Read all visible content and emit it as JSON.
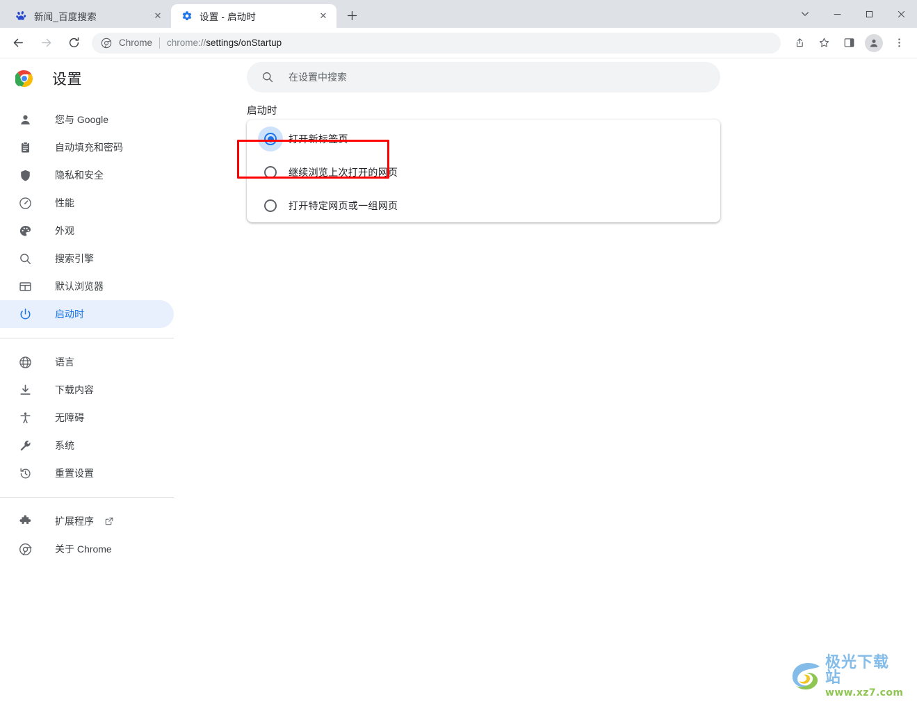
{
  "window": {
    "controls": [
      {
        "name": "tab-search-button",
        "icon": "chevron-down-icon",
        "glyph": "⌄"
      },
      {
        "name": "minimize-button",
        "icon": "minimize-icon",
        "glyph": "–"
      },
      {
        "name": "maximize-button",
        "icon": "maximize-icon",
        "glyph": "□"
      },
      {
        "name": "close-button",
        "icon": "close-icon",
        "glyph": "✕"
      }
    ]
  },
  "tabs": [
    {
      "title": "新闻_百度搜索",
      "favicon": "baidu-paw-icon",
      "active": false,
      "close_label": "✕"
    },
    {
      "title": "设置 - 启动时",
      "favicon": "settings-gear-icon",
      "active": true,
      "close_label": "✕"
    }
  ],
  "new_tab_button": {
    "label": "+",
    "icon": "plus-icon"
  },
  "toolbar": {
    "back": {
      "icon": "back-arrow-icon",
      "glyph": "←"
    },
    "forward": {
      "icon": "forward-arrow-icon",
      "glyph": "→"
    },
    "reload": {
      "icon": "reload-icon",
      "glyph": "↻"
    },
    "omnibox": {
      "site_icon": "chrome-shield-icon",
      "chip_word": "Chrome",
      "url_prefix": "chrome://",
      "url_emphasis": "settings/onStartup",
      "full_url": "chrome://settings/onStartup"
    },
    "share": {
      "icon": "share-icon"
    },
    "bookmark": {
      "icon": "star-icon"
    },
    "side_panel": {
      "icon": "side-panel-icon"
    },
    "profile": {
      "icon": "avatar-icon"
    },
    "menu": {
      "icon": "three-dot-menu-icon",
      "glyph": "⋮"
    }
  },
  "sidebar": {
    "brand": {
      "logo": "chrome-logo-icon",
      "title": "设置"
    },
    "groups": [
      {
        "items": [
          {
            "label": "您与 Google",
            "icon": "person-icon",
            "selected": false
          },
          {
            "label": "自动填充和密码",
            "icon": "clipboard-icon",
            "selected": false
          },
          {
            "label": "隐私和安全",
            "icon": "shield-icon",
            "selected": false
          },
          {
            "label": "性能",
            "icon": "speedometer-icon",
            "selected": false
          },
          {
            "label": "外观",
            "icon": "palette-icon",
            "selected": false
          },
          {
            "label": "搜索引擎",
            "icon": "search-icon",
            "selected": false
          },
          {
            "label": "默认浏览器",
            "icon": "browser-window-icon",
            "selected": false
          },
          {
            "label": "启动时",
            "icon": "power-icon",
            "selected": true
          }
        ]
      },
      {
        "items": [
          {
            "label": "语言",
            "icon": "globe-icon",
            "selected": false
          },
          {
            "label": "下载内容",
            "icon": "download-icon",
            "selected": false
          },
          {
            "label": "无障碍",
            "icon": "accessibility-icon",
            "selected": false
          },
          {
            "label": "系统",
            "icon": "wrench-icon",
            "selected": false
          },
          {
            "label": "重置设置",
            "icon": "history-restore-icon",
            "selected": false
          }
        ]
      },
      {
        "items": [
          {
            "label": "扩展程序",
            "icon": "puzzle-icon",
            "selected": false,
            "external_icon": "open-in-new-icon"
          },
          {
            "label": "关于 Chrome",
            "icon": "chrome-outline-icon",
            "selected": false
          }
        ]
      }
    ]
  },
  "main": {
    "search": {
      "icon": "search-icon",
      "placeholder": "在设置中搜索",
      "value": ""
    },
    "section_title": "启动时",
    "startup_options": [
      {
        "label": "打开新标签页",
        "checked": true
      },
      {
        "label": "继续浏览上次打开的网页",
        "checked": false
      },
      {
        "label": "打开特定网页或一组网页",
        "checked": false
      }
    ]
  },
  "annotation": {
    "highlight_color": "#ff0000",
    "target": "打开新标签页"
  },
  "watermark": {
    "title": "极光下载站",
    "url": "www.xz7.com",
    "icon": "swirl-logo-icon"
  }
}
